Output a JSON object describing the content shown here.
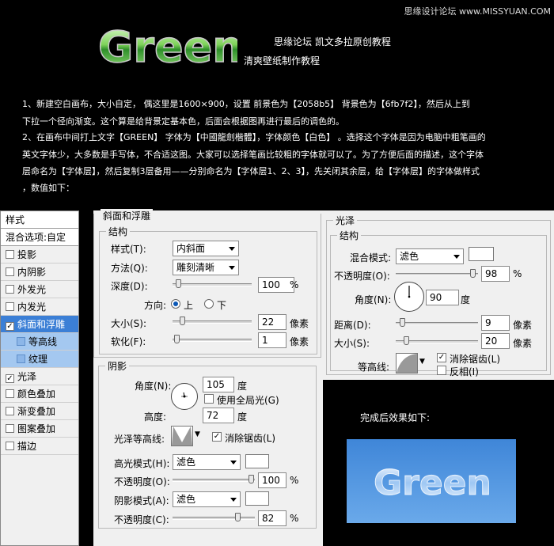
{
  "header": {
    "logo_text": "Green",
    "credit_line1": "思缘论坛   凯文多拉原创教程",
    "credit_line2": "清爽壁纸制作教程",
    "watermark": "思缘设计论坛  www.MISSYUAN.COM"
  },
  "intro": {
    "line1": "1、新建空白画布，大小自定，  偶这里是1600×900，设置      前景色为【2058b5】  背景色为【6fb7f2】，然后从上到",
    "line2": "下拉一个径向渐变。这个算是给背景定基本色，后面会根据图再进行最后的调色的。",
    "line3": "2、在画布中间打上文字【GREEN】  字体为【中國龍劍楷體】，字体颜色【白色】  。选择这个字体是因为电脑中粗笔画的",
    "line4": "英文字体少，大多数是手写体，不合适这图。大家可以选择笔画比较粗的字体就可以了。为了方便后面的描述，这个字体",
    "line5": "层命名为【字体层】，然后复制3层备用——分别命名为【字体层1、2、3】，先关闭其余层，给【字体层】的字体做样式",
    "line6": "，数值如下："
  },
  "styles_panel": {
    "title": "样式",
    "blend": "混合选项:自定",
    "items": [
      {
        "label": "投影",
        "checked": false
      },
      {
        "label": "内阴影",
        "checked": false
      },
      {
        "label": "外发光",
        "checked": false
      },
      {
        "label": "内发光",
        "checked": false
      },
      {
        "label": "斜面和浮雕",
        "checked": true
      },
      {
        "label": "等高线",
        "checked": false
      },
      {
        "label": "纹理",
        "checked": false
      },
      {
        "label": "光泽",
        "checked": true
      },
      {
        "label": "颜色叠加",
        "checked": false
      },
      {
        "label": "渐变叠加",
        "checked": false
      },
      {
        "label": "图案叠加",
        "checked": false
      },
      {
        "label": "描边",
        "checked": false
      }
    ],
    "check_mark": "✓"
  },
  "bevel": {
    "title": "斜面和浮雕",
    "structure_title": "结构",
    "style_label": "样式(T):",
    "style_value": "内斜面",
    "technique_label": "方法(Q):",
    "technique_value": "雕刻清晰",
    "depth_label": "深度(D):",
    "depth_value": "100",
    "depth_level": 0.04,
    "percent": "%",
    "direction_label": "方向:",
    "dir_up": "上",
    "dir_down": "下",
    "size_label": "大小(S):",
    "size_value": "22",
    "size_level": 0.1,
    "pixels": "像素",
    "soften_label": "软化(F):",
    "soften_value": "1",
    "soften_level": 0.02
  },
  "shading": {
    "title": "阴影",
    "angle_label": "角度(N):",
    "angle_value": "105",
    "degree": "度",
    "global_light_label": "使用全局光(G)",
    "altitude_label": "高度:",
    "altitude_value": "72",
    "gloss_contour_label": "光泽等高线:",
    "anti_alias_label": "消除锯齿(L)",
    "highlight_mode_label": "高光模式(H):",
    "highlight_mode_value": "滤色",
    "highlight_color": "#ffffff",
    "opacity_label": "不透明度(O):",
    "highlight_opacity": "100",
    "highlight_opacity_level": 1.0,
    "shadow_mode_label": "阴影模式(A):",
    "shadow_mode_value": "滤色",
    "shadow_color": "#ffffff",
    "shadow_opacity_label": "不透明度(C):",
    "shadow_opacity": "82",
    "shadow_opacity_level": 0.82
  },
  "satin": {
    "title": "光泽",
    "structure_title": "结构",
    "blend_label": "混合模式:",
    "blend_value": "滤色",
    "color": "#ffffff",
    "opacity_label": "不透明度(O):",
    "opacity_value": "98",
    "opacity_level": 0.98,
    "percent": "%",
    "angle_label": "角度(N):",
    "angle_value": "90",
    "degree": "度",
    "distance_label": "距离(D):",
    "distance_value": "9",
    "distance_level": 0.05,
    "size_label": "大小(S):",
    "size_value": "20",
    "size_level": 0.1,
    "pixels": "像素",
    "contour_label": "等高线:",
    "anti_alias_label": "消除锯齿(L)",
    "invert_label": "反相(I)"
  },
  "result": {
    "title": "完成后效果如下:",
    "text": "Green"
  }
}
